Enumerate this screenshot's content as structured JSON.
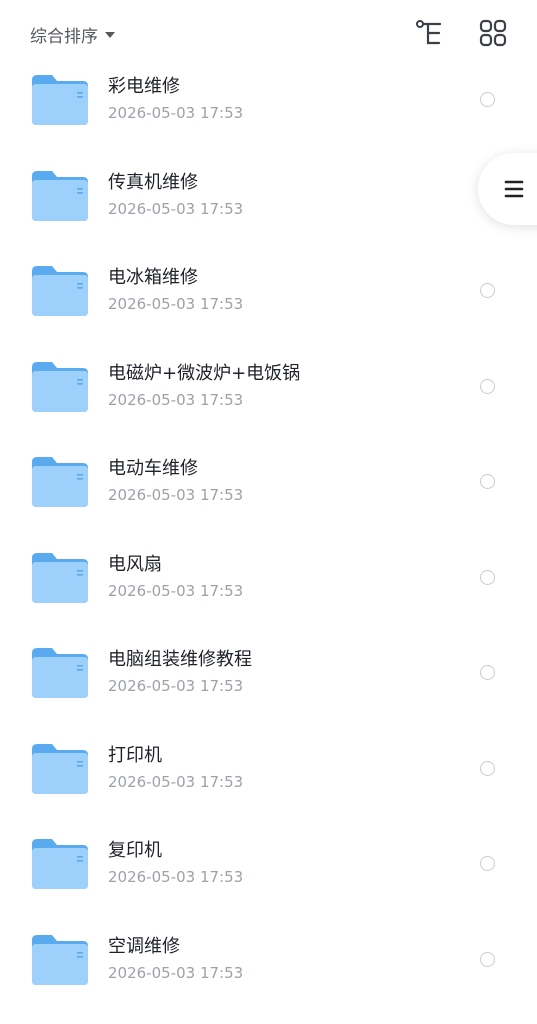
{
  "header": {
    "sort_label": "综合排序",
    "tree_icon": "tree-view-icon",
    "grid_icon": "grid-view-icon"
  },
  "colors": {
    "folder_light": "#9dd0fb",
    "folder_dark": "#5aaaf0",
    "title_text": "#1f2329",
    "meta_text": "#9da2a8"
  },
  "side_handle": {
    "icon": "menu-lines-icon"
  },
  "files": [
    {
      "name": "彩电维修",
      "date": "2026-05-03 17:53"
    },
    {
      "name": "传真机维修",
      "date": "2026-05-03 17:53"
    },
    {
      "name": "电冰箱维修",
      "date": "2026-05-03 17:53"
    },
    {
      "name": "电磁炉+微波炉+电饭锅",
      "date": "2026-05-03 17:53"
    },
    {
      "name": "电动车维修",
      "date": "2026-05-03 17:53"
    },
    {
      "name": "电风扇",
      "date": "2026-05-03 17:53"
    },
    {
      "name": "电脑组装维修教程",
      "date": "2026-05-03 17:53"
    },
    {
      "name": "打印机",
      "date": "2026-05-03 17:53"
    },
    {
      "name": "复印机",
      "date": "2026-05-03 17:53"
    },
    {
      "name": "空调维修",
      "date": "2026-05-03 17:53"
    }
  ]
}
